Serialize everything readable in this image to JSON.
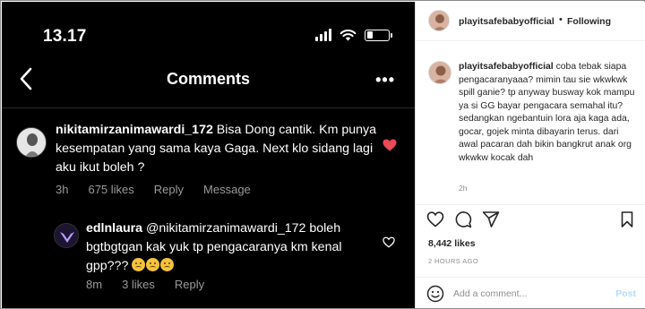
{
  "phone": {
    "time": "13.17",
    "title": "Comments",
    "comment": {
      "username": "nikitamirzanimawardi_172",
      "text": " Bisa Dong cantik. Km punya kesempatan yang sama kaya Gaga. Next klo sidang lagi aku ikut boleh ?",
      "age": "3h",
      "likes": "675 likes",
      "reply_label": "Reply",
      "message_label": "Message"
    },
    "reply": {
      "username": "edlnlaura",
      "text": " @nikitamirzanimawardi_172 boleh bgtbgtgan kak yuk tp pengacaranya km kenal gpp???",
      "age": "8m",
      "likes": "3 likes",
      "reply_label": "Reply"
    }
  },
  "post": {
    "username": "playitsafebabyofficial",
    "dot": "•",
    "follow_status": "Following",
    "caption_username": "playitsafebabyofficial",
    "caption": " coba tebak siapa pengacaranyaaa? mimin tau sie wkwkwk spill ganie? tp anyway busway kok mampu ya si GG bayar pengacara semahal itu? sedangkan ngebantuin lora aja kaga ada, gocar, gojek minta dibayarin terus. dari awal pacaran dah bikin bangkrut anak org wkwkw kocak dah",
    "caption_age": "2h",
    "likes": "8,442 likes",
    "posted": "2 HOURS AGO",
    "add_comment_placeholder": "Add a comment...",
    "post_label": "Post"
  },
  "colors": {
    "heart_red": "#ed4956",
    "post_disabled": "#b3dbff",
    "muted_gray": "#9a9a9a"
  }
}
